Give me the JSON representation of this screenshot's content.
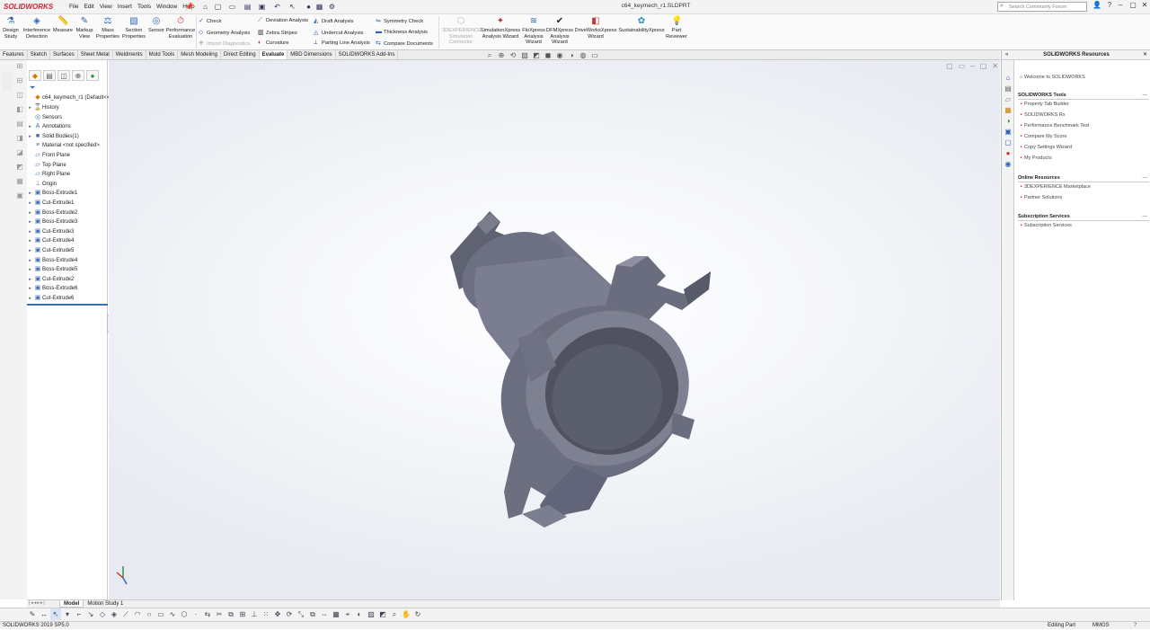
{
  "app": {
    "logo_text": "SOLIDWORKS",
    "document_title": "c64_keymech_r1.SLDPRT"
  },
  "menu": [
    "File",
    "Edit",
    "View",
    "Insert",
    "Tools",
    "Window",
    "Help"
  ],
  "search": {
    "placeholder": "Search Community Forum"
  },
  "ribbon": {
    "design_study": "Design Study",
    "interference": "Interference Detection",
    "measure": "Measure",
    "markup_view": "Markup View",
    "mass_properties": "Mass Properties",
    "section_properties": "Section Properties",
    "sensor": "Sensor",
    "performance_eval": "Performance Evaluation",
    "check": "Check",
    "geometry_analysis": "Geometry Analysis",
    "import_diagnostics": "Import Diagnostics",
    "deviation_analysis": "Deviation Analysis",
    "zebra_stripes": "Zebra Stripes",
    "curvature": "Curvature",
    "draft_analysis": "Draft Analysis",
    "undercut_analysis": "Undercut Analysis",
    "parting_line": "Parting Line Analysis",
    "symmetry_check": "Symmetry Check",
    "thickness_analysis": "Thickness Analysis",
    "compare_documents": "Compare Documents",
    "xpr_connector": "3DEXPERIENCE Simulation Connector",
    "simxpress": "SimulationXpress Analysis Wizard",
    "floxpress": "FloXpress Analysis Wizard",
    "dfmxpress": "DFMXpress Analysis Wizard",
    "driveworks": "DriveWorksXpress Wizard",
    "sustainability": "SustainabilityXpress",
    "part_reviewer": "Part Reviewer"
  },
  "command_tabs": [
    {
      "label": "Features",
      "active": false
    },
    {
      "label": "Sketch",
      "active": false
    },
    {
      "label": "Surfaces",
      "active": false
    },
    {
      "label": "Sheet Metal",
      "active": false
    },
    {
      "label": "Weldments",
      "active": false
    },
    {
      "label": "Mold Tools",
      "active": false
    },
    {
      "label": "Mesh Modeling",
      "active": false
    },
    {
      "label": "Direct Editing",
      "active": false
    },
    {
      "label": "Evaluate",
      "active": true
    },
    {
      "label": "MBD Dimensions",
      "active": false
    },
    {
      "label": "SOLIDWORKS Add-Ins",
      "active": false
    }
  ],
  "feature_tree": {
    "root": "c64_keymech_r1  (Default<<D",
    "items": [
      {
        "label": "History",
        "icon": "history-icon",
        "glyph": "⌛",
        "expand": true
      },
      {
        "label": "Sensors",
        "icon": "sensor-icon",
        "glyph": "◎",
        "expand": false
      },
      {
        "label": "Annotations",
        "icon": "annotation-icon",
        "glyph": "A",
        "expand": true
      },
      {
        "label": "Solid Bodies(1)",
        "icon": "solid-body-icon",
        "glyph": "■",
        "expand": true
      },
      {
        "label": "Material <not specified>",
        "icon": "material-icon",
        "glyph": "≡",
        "expand": false
      },
      {
        "label": "Front Plane",
        "icon": "plane-icon",
        "glyph": "▱",
        "expand": false
      },
      {
        "label": "Top Plane",
        "icon": "plane-icon",
        "glyph": "▱",
        "expand": false
      },
      {
        "label": "Right Plane",
        "icon": "plane-icon",
        "glyph": "▱",
        "expand": false
      },
      {
        "label": "Origin",
        "icon": "origin-icon",
        "glyph": "⊥",
        "expand": false
      },
      {
        "label": "Boss-Extrude1",
        "icon": "extrude-icon",
        "glyph": "▣",
        "expand": true
      },
      {
        "label": "Cut-Extrude1",
        "icon": "cut-icon",
        "glyph": "▣",
        "expand": true
      },
      {
        "label": "Boss-Extrude2",
        "icon": "extrude-icon",
        "glyph": "▣",
        "expand": true
      },
      {
        "label": "Boss-Extrude3",
        "icon": "extrude-icon",
        "glyph": "▣",
        "expand": true
      },
      {
        "label": "Cut-Extrude3",
        "icon": "cut-icon",
        "glyph": "▣",
        "expand": true
      },
      {
        "label": "Cut-Extrude4",
        "icon": "cut-icon",
        "glyph": "▣",
        "expand": true
      },
      {
        "label": "Cut-Extrude5",
        "icon": "cut-icon",
        "glyph": "▣",
        "expand": true
      },
      {
        "label": "Boss-Extrude4",
        "icon": "extrude-icon",
        "glyph": "▣",
        "expand": true
      },
      {
        "label": "Boss-Extrude5",
        "icon": "extrude-icon",
        "glyph": "▣",
        "expand": true
      },
      {
        "label": "Cut-Extrude2",
        "icon": "cut-icon",
        "glyph": "▣",
        "expand": true
      },
      {
        "label": "Boss-Extrude6",
        "icon": "extrude-icon",
        "glyph": "▣",
        "expand": true
      },
      {
        "label": "Cut-Extrude6",
        "icon": "cut-icon",
        "glyph": "▣",
        "expand": true
      }
    ]
  },
  "task_pane": {
    "title": "SOLIDWORKS Resources",
    "welcome": "Welcome to SOLIDWORKS",
    "tools_header": "SOLIDWORKS Tools",
    "tools": [
      "Property Tab Builder",
      "SOLIDWORKS Rx",
      "Performance Benchmark Test",
      "Compare My Score",
      "Copy Settings Wizard",
      "My Products"
    ],
    "online_header": "Online Resources",
    "online": [
      "3DEXPERIENCE Marketplace",
      "Partner Solutions"
    ],
    "subscription_header": "Subscription Services",
    "subscription": [
      "Subscription Services"
    ]
  },
  "bottom_tabs": [
    {
      "label": "Model",
      "active": true
    },
    {
      "label": "Motion Study 1",
      "active": false
    }
  ],
  "status": {
    "left": "SOLIDWORKS 2019 SP5.0",
    "editing": "Editing Part",
    "units": "MMGS",
    "help_icon": "?"
  },
  "colors": {
    "accent": "#2a63b8",
    "brand_red": "#d01f2e",
    "part_gray": "#6e7180"
  }
}
